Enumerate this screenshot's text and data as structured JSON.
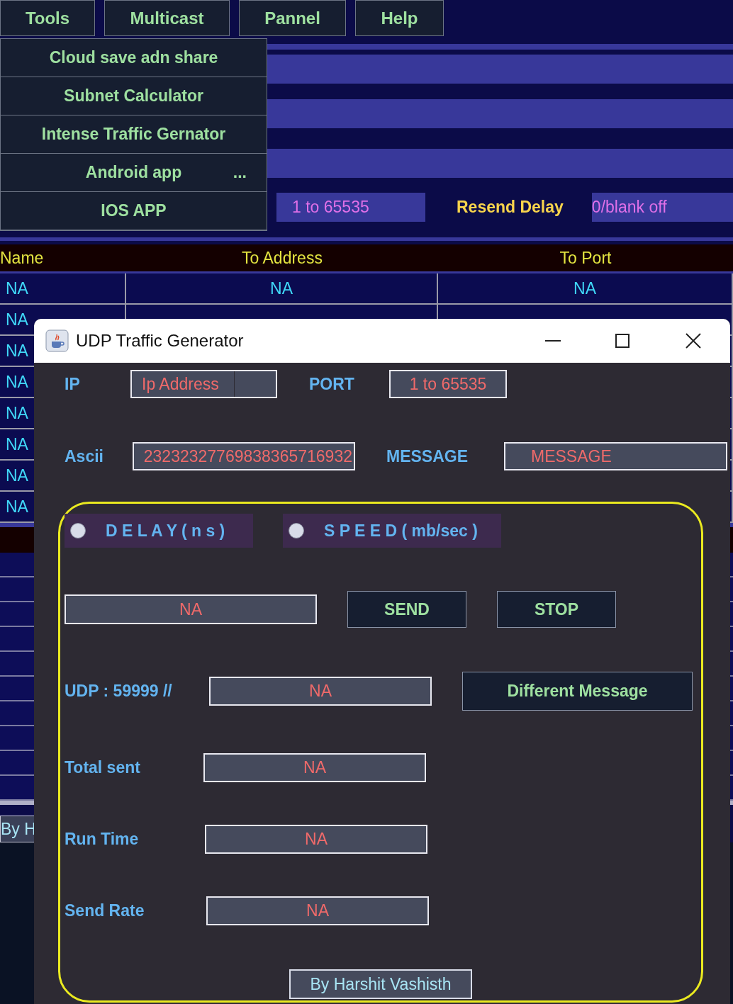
{
  "menubar": [
    {
      "label": "Tools"
    },
    {
      "label": "Multicast"
    },
    {
      "label": "Pannel"
    },
    {
      "label": "Help"
    }
  ],
  "tools_menu": [
    {
      "label": "Cloud save adn share"
    },
    {
      "label": "Subnet Calculator"
    },
    {
      "label": "Intense  Traffic Gernator"
    },
    {
      "label": "Android  app",
      "suffix": "..."
    },
    {
      "label": "IOS  APP"
    }
  ],
  "settings_row": {
    "port_field": {
      "value": "1 to 65535"
    },
    "resend_delay_label": "Resend Delay",
    "resend_delay_field": {
      "value": "0/blank off"
    }
  },
  "table": {
    "columns": [
      "Name",
      "To Address",
      "To Port"
    ],
    "rows": [
      [
        "NA",
        "NA",
        "NA"
      ],
      [
        "NA"
      ],
      [
        "NA"
      ],
      [
        "NA"
      ],
      [
        "NA"
      ],
      [
        "NA"
      ],
      [
        "NA"
      ],
      [
        "NA"
      ]
    ]
  },
  "footer_button": "By H",
  "dialog": {
    "title": "UDP Traffic Generator",
    "ip": {
      "label": "IP",
      "value": "Ip Address"
    },
    "port": {
      "label": "PORT",
      "value": "1 to 65535"
    },
    "ascii": {
      "label": "Ascii",
      "value": "23232327769838365716932"
    },
    "message": {
      "label": "MESSAGE",
      "value": "MESSAGE"
    },
    "modes": [
      {
        "label": "D E L A Y ( n s )",
        "checked": false
      },
      {
        "label": "S P E E D ( mb/sec )",
        "checked": false
      }
    ],
    "amount_field": {
      "value": "NA"
    },
    "buttons": [
      "SEND",
      "STOP"
    ],
    "udp": {
      "label": "UDP : 59999 //",
      "value": "NA",
      "button": "Different Message"
    },
    "stats": [
      {
        "label": "Total sent",
        "value": "NA"
      },
      {
        "label": "Run Time",
        "value": "NA"
      },
      {
        "label": "Send Rate",
        "value": "NA"
      }
    ],
    "credit": "By Harshit Vashisth"
  }
}
